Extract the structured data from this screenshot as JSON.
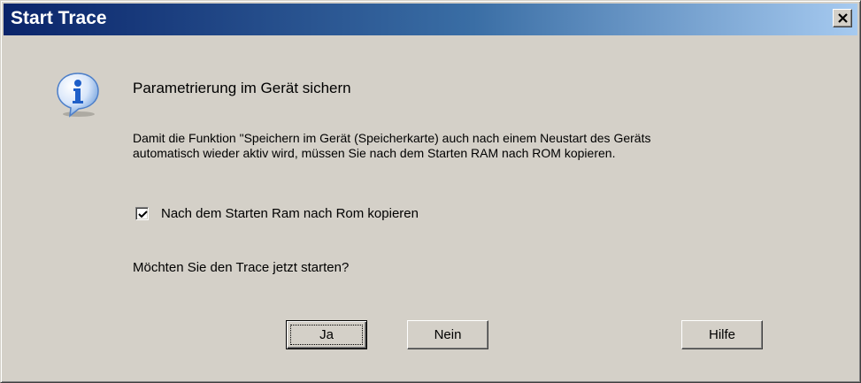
{
  "window": {
    "title": "Start Trace",
    "close_icon": "close-x-icon"
  },
  "dialog": {
    "icon": "info-icon",
    "heading": "Parametrierung im Gerät sichern",
    "body_line1": "Damit die Funktion \"Speichern im Gerät (Speicherkarte) auch nach einem Neustart des Geräts",
    "body_line2": "automatisch wieder aktiv wird, müssen Sie nach dem Starten RAM nach ROM kopieren.",
    "checkbox": {
      "label": "Nach dem Starten Ram nach Rom kopieren",
      "checked": true
    },
    "question": "Möchten Sie den Trace jetzt starten?"
  },
  "buttons": {
    "yes_label": "Ja",
    "no_label": "Nein",
    "help_label": "Hilfe"
  },
  "colors": {
    "titlebar_start": "#0a246a",
    "titlebar_end": "#a6caf0",
    "dialog_bg": "#d4d0c8",
    "icon_blue": "#1f5fc8"
  }
}
